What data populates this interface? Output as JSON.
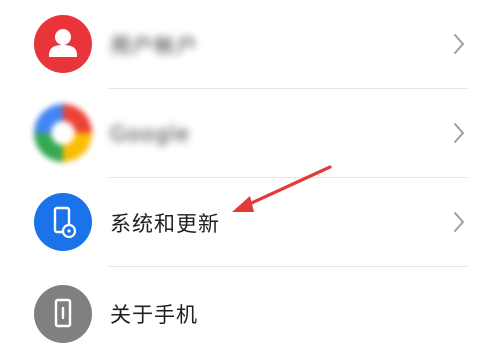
{
  "items": [
    {
      "label": "用户帐户",
      "icon": "account-icon",
      "color": "#e8343a",
      "blurred": true
    },
    {
      "label": "Google",
      "icon": "google-icon",
      "color": "#4285f4",
      "blurred": true
    },
    {
      "label": "系统和更新",
      "icon": "system-update-icon",
      "color": "#1a73e8",
      "blurred": false
    },
    {
      "label": "关于手机",
      "icon": "about-phone-icon",
      "color": "#808080",
      "blurred": false
    }
  ],
  "annotation": {
    "color": "#e53935",
    "target": "系统和更新"
  }
}
